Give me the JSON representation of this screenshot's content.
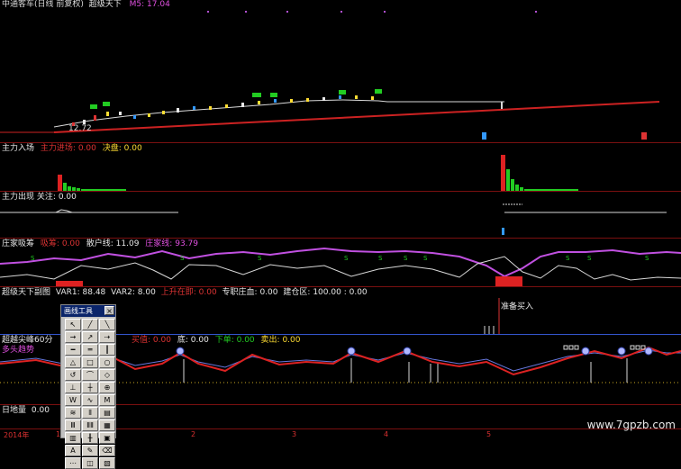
{
  "main_header": {
    "title": "中通客车(日线 前复权)",
    "indicator": "超级天下",
    "ma_label": "M5: 17.04",
    "low_price": "12.72"
  },
  "volume_header": {
    "name": "主力入场",
    "field1_label": "主力进场:",
    "field1_value": "0.00",
    "field2_label": "决盘:",
    "field2_value": "0.00"
  },
  "attention_header": {
    "name": "主力出现",
    "field_label": "关注:",
    "field_value": "0.00"
  },
  "banker_header": {
    "name": "庄家吸筹",
    "f1_label": "吸筹:",
    "f1_value": "0.00",
    "f2_label": "散户线:",
    "f2_value": "11.09",
    "f3_label": "庄家线:",
    "f3_value": "93.79"
  },
  "sub_header": {
    "name": "超级天下副图",
    "v1_label": "VAR1:",
    "v1_value": "88.48",
    "v2_label": "VAR2:",
    "v2_value": "8.00",
    "v3_label": "上升在即:",
    "v3_value": "0.00",
    "v4_label": "专职庄血:",
    "v4_value": "0.00",
    "v5_label": "建仓区:",
    "v5_value": "100.00",
    "v6_label": ":",
    "v6_value": "0.00",
    "annotation": "准备买入"
  },
  "osc_header": {
    "name": "超越尖峰60分",
    "tag": "多头趋势",
    "f1_label": "买值:",
    "f1_value": "0.00",
    "f2_label": "底:",
    "f2_value": "0.00",
    "f3_label": "下单:",
    "f3_value": "0.00",
    "f4_label": "卖出:",
    "f4_value": "0.00"
  },
  "bottom_header": {
    "name": "日地量",
    "field_value": "0.00"
  },
  "toolbox": {
    "title": "画线工具",
    "close": "×",
    "tools": [
      "↖",
      "╱",
      "╲",
      "→",
      "↗",
      "⇢",
      "━",
      "═",
      "┃",
      "△",
      "□",
      "○",
      "↺",
      "⌒",
      "◇",
      "⊥",
      "┼",
      "⊕",
      "W",
      "∿",
      "M",
      "≋",
      "⫴",
      "▤",
      "Ⅲ",
      "ⅡⅡ",
      "▦",
      "▥",
      "╫",
      "▣",
      "A",
      "✎",
      "⌫",
      "⋯",
      "◫",
      "▧"
    ]
  },
  "axis": {
    "year_label": "2014年",
    "ticks": [
      "12",
      "2",
      "3",
      "4",
      "5"
    ]
  },
  "watermark": "www.7gpzb.com",
  "colors": {
    "background": "#000000",
    "separator": "#7a1010",
    "trend": "#cc2222",
    "magenta": "#b050d0",
    "green": "#22cc22"
  }
}
